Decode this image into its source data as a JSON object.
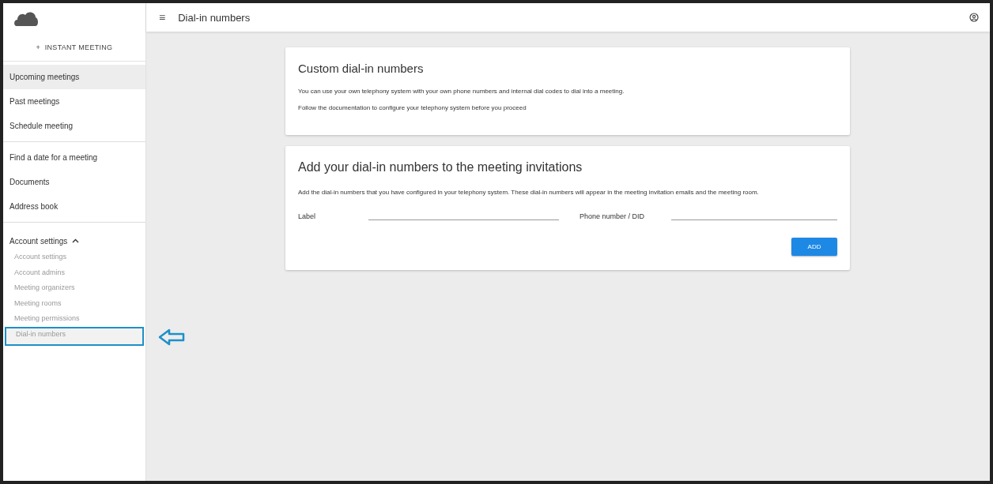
{
  "sidebar": {
    "instant_meeting": {
      "icon": "+",
      "label": "INSTANT MEETING"
    },
    "groups": [
      [
        {
          "label": "Upcoming meetings",
          "selected": true
        },
        {
          "label": "Past meetings",
          "selected": false
        },
        {
          "label": "Schedule meeting",
          "selected": false
        }
      ],
      [
        {
          "label": "Find a date for a meeting",
          "selected": false
        },
        {
          "label": "Documents",
          "selected": false
        },
        {
          "label": "Address book",
          "selected": false
        }
      ]
    ],
    "account_settings": {
      "label": "Account settings",
      "expanded": true,
      "children": [
        {
          "label": "Account settings",
          "selected": false,
          "highlighted": false
        },
        {
          "label": "Account admins",
          "selected": false,
          "highlighted": false
        },
        {
          "label": "Meeting organizers",
          "selected": false,
          "highlighted": false
        },
        {
          "label": "Meeting rooms",
          "selected": false,
          "highlighted": false
        },
        {
          "label": "Meeting permissions",
          "selected": false,
          "highlighted": false
        },
        {
          "label": "Dial-in numbers",
          "selected": true,
          "highlighted": true
        }
      ]
    }
  },
  "top_bar": {
    "menu_icon": "≡",
    "title": "Dial-in numbers"
  },
  "cards": [
    {
      "title": "Custom dial-in numbers",
      "paragraphs": [
        "You can use your own telephony system with your own phone numbers and internal dial codes to dial into a meeting.",
        "Follow the documentation to configure your telephony system before you proceed"
      ]
    },
    {
      "title": "Add your dial-in numbers to the meeting invitations",
      "paragraphs": [
        "Add the dial-in numbers that you have configured in your telephony system. These dial-in numbers will appear in the meeting invitation emails and the meeting room."
      ],
      "fields": [
        {
          "label": "Label"
        },
        {
          "label": "Phone number / DID"
        }
      ],
      "button": "ADD"
    }
  ]
}
